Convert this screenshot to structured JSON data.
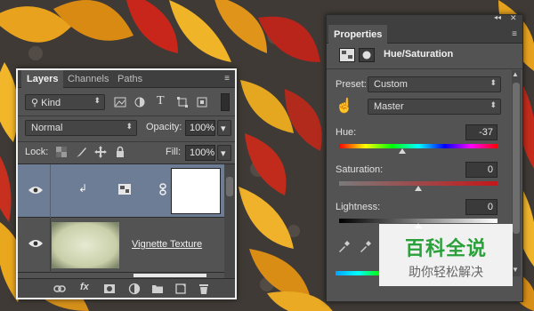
{
  "layers_panel": {
    "tabs": [
      "Layers",
      "Channels",
      "Paths"
    ],
    "active_tab": "Layers",
    "filter_kind": "Kind",
    "blend_mode": "Normal",
    "opacity_label": "Opacity:",
    "opacity_value": "100%",
    "lock_label": "Lock:",
    "fill_label": "Fill:",
    "fill_value": "100%",
    "layers": [
      {
        "name": "",
        "type": "adjustment-hue-saturation",
        "selected": true,
        "clipped": true
      },
      {
        "name": "Vignette Texture",
        "type": "image",
        "selected": false
      }
    ],
    "footer_icons": [
      "link-icon",
      "fx-icon",
      "mask-icon",
      "adjustment-icon",
      "folder-icon",
      "new-layer-icon",
      "trash-icon"
    ],
    "footer_fx": "fx"
  },
  "properties_panel": {
    "tab": "Properties",
    "title": "Hue/Saturation",
    "preset_label": "Preset:",
    "preset_value": "Custom",
    "channel_value": "Master",
    "hue_label": "Hue:",
    "hue_value": "-37",
    "hue_level": -37,
    "saturation_label": "Saturation:",
    "saturation_value": "0",
    "saturation_level": 0,
    "lightness_label": "Lightness:",
    "lightness_value": "0",
    "lightness_level": 0
  },
  "watermark": {
    "line1": "百科全说",
    "line2": "助你轻松解决"
  },
  "colors": {
    "panel_bg": "#535353",
    "selected_layer": "#6d7d95",
    "watermark_green": "#2aa03a"
  }
}
